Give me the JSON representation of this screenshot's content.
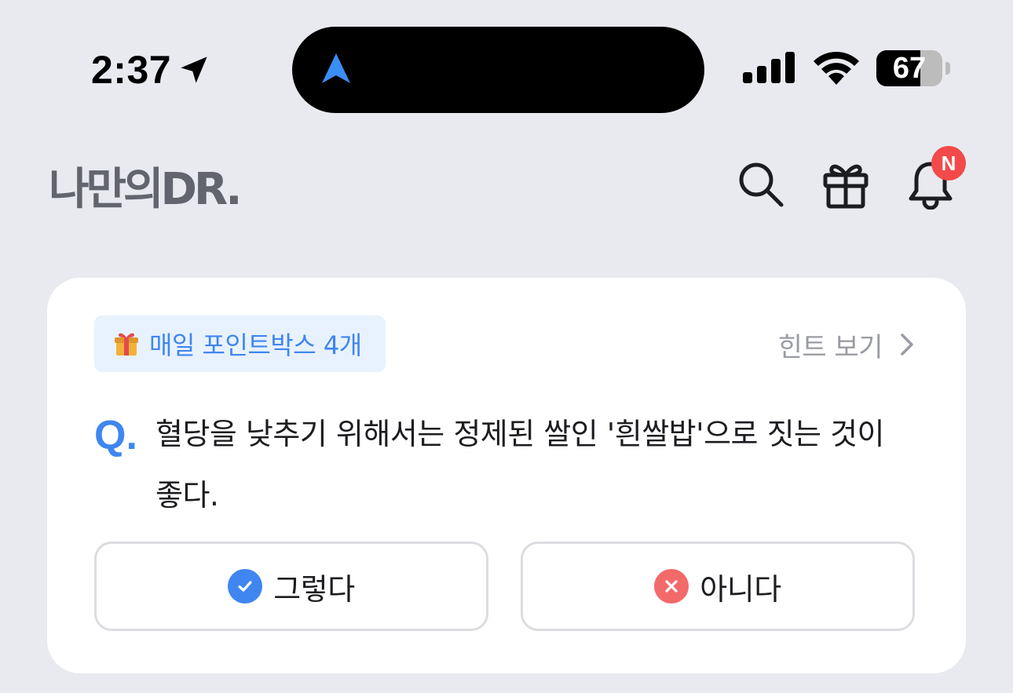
{
  "status_bar": {
    "time": "2:37",
    "battery_level": "67",
    "battery_fraction": 0.67,
    "location_icon": "location-arrow-icon",
    "navigation_icon": "navigation-arrow-icon",
    "signal_icon": "cellular-signal-icon",
    "wifi_icon": "wifi-icon"
  },
  "header": {
    "logo_text": "나만의DR.",
    "search_icon": "search-icon",
    "gift_icon": "gift-icon",
    "bell_icon": "bell-icon",
    "notification_badge": "N"
  },
  "quiz_card": {
    "reward_chip": "매일 포인트박스 4개",
    "hint_link": "힌트 보기",
    "question_prefix": "Q.",
    "question_text": "혈당을 낮추기 위해서는 정제된 쌀인 '흰쌀밥'으로 짓는 것이 좋다.",
    "answer_yes": "그렇다",
    "answer_no": "아니다"
  },
  "colors": {
    "background": "#e9eaef",
    "accent_blue": "#3f86f0",
    "danger_red": "#f36a6a",
    "badge_red": "#f24a4a",
    "chip_bg": "#e8f2ff",
    "logo_gray": "#62656d"
  }
}
